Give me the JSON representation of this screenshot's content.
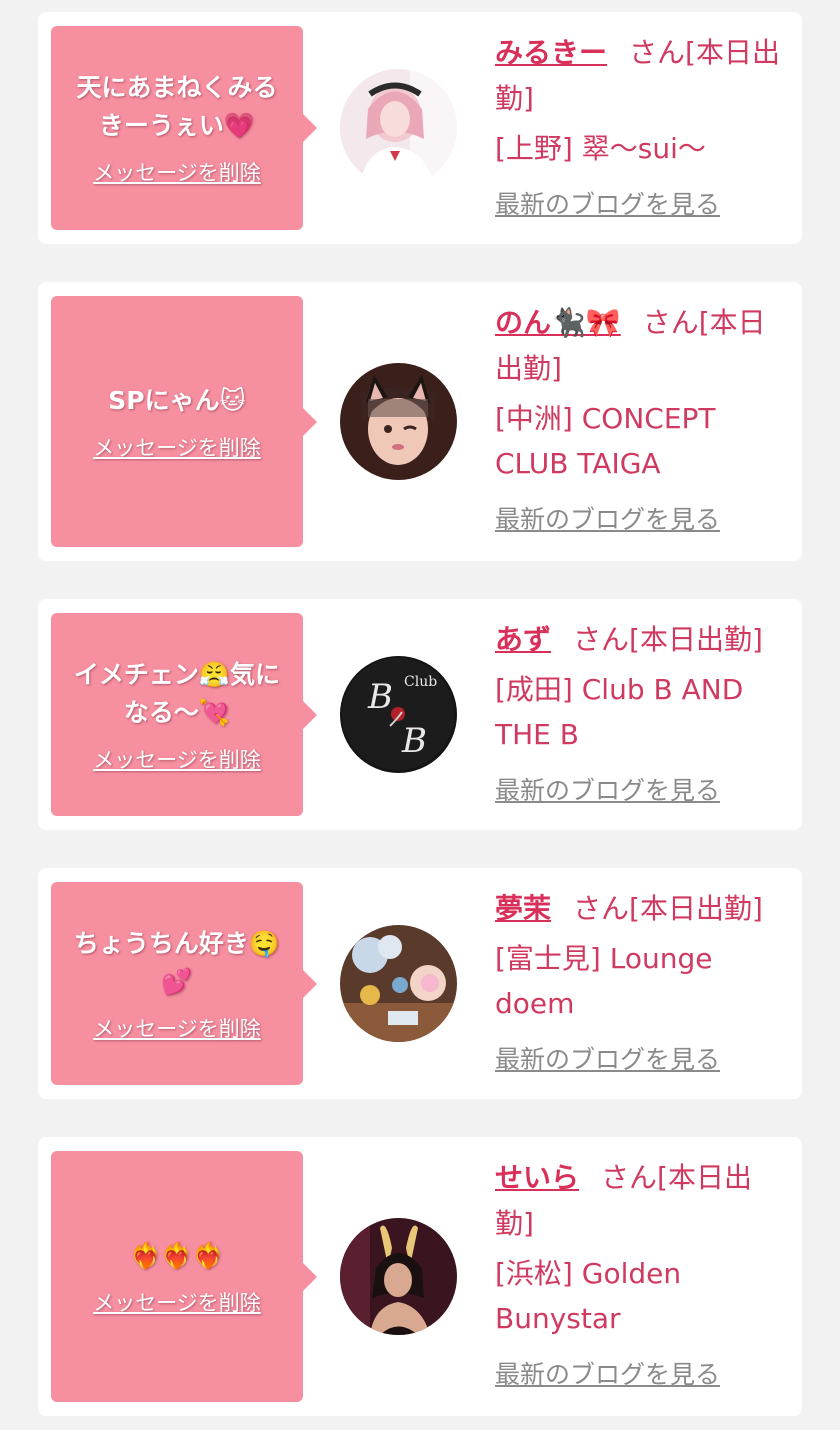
{
  "delete_label": "メッセージを削除",
  "blog_label": "最新のブログを見る",
  "cards": [
    {
      "message": "天にあまねくみるきーうぇい💗",
      "name": "みるきー",
      "status": "さん[本日出勤]",
      "shop": "[上野] 翠〜sui〜"
    },
    {
      "message": "SPにゃん🐱",
      "name": "のん🐈‍⬛🎀",
      "status": "さん[本日出勤]",
      "shop": "[中洲] CONCEPT CLUB TAIGA"
    },
    {
      "message": "イメチェン😤気になる〜💘",
      "name": "あず",
      "status": "さん[本日出勤]",
      "shop": "[成田] Club B AND THE B"
    },
    {
      "message": "ちょうちん好き🤤💕",
      "name": "夢茉",
      "status": "さん[本日出勤]",
      "shop": "[富士見] Lounge doem"
    },
    {
      "message": "❤️‍🔥❤️‍🔥❤️‍🔥",
      "name": "せいら",
      "status": "さん[本日出勤]",
      "shop": "[浜松] Golden Bunystar"
    }
  ],
  "avatars": [
    {
      "icon": "avatar-photo-maid-girl"
    },
    {
      "icon": "avatar-photo-cat-ear-girl"
    },
    {
      "icon": "avatar-logo-club-b-and-the-b"
    },
    {
      "icon": "avatar-photo-party-table"
    },
    {
      "icon": "avatar-photo-bunny-girl"
    }
  ],
  "colors": {
    "page_bg": "#f2f2f2",
    "bubble_bg": "#f68fa0",
    "name": "#d9305a",
    "text_accent": "#d03a60",
    "blog_link": "#8a8a8a"
  }
}
